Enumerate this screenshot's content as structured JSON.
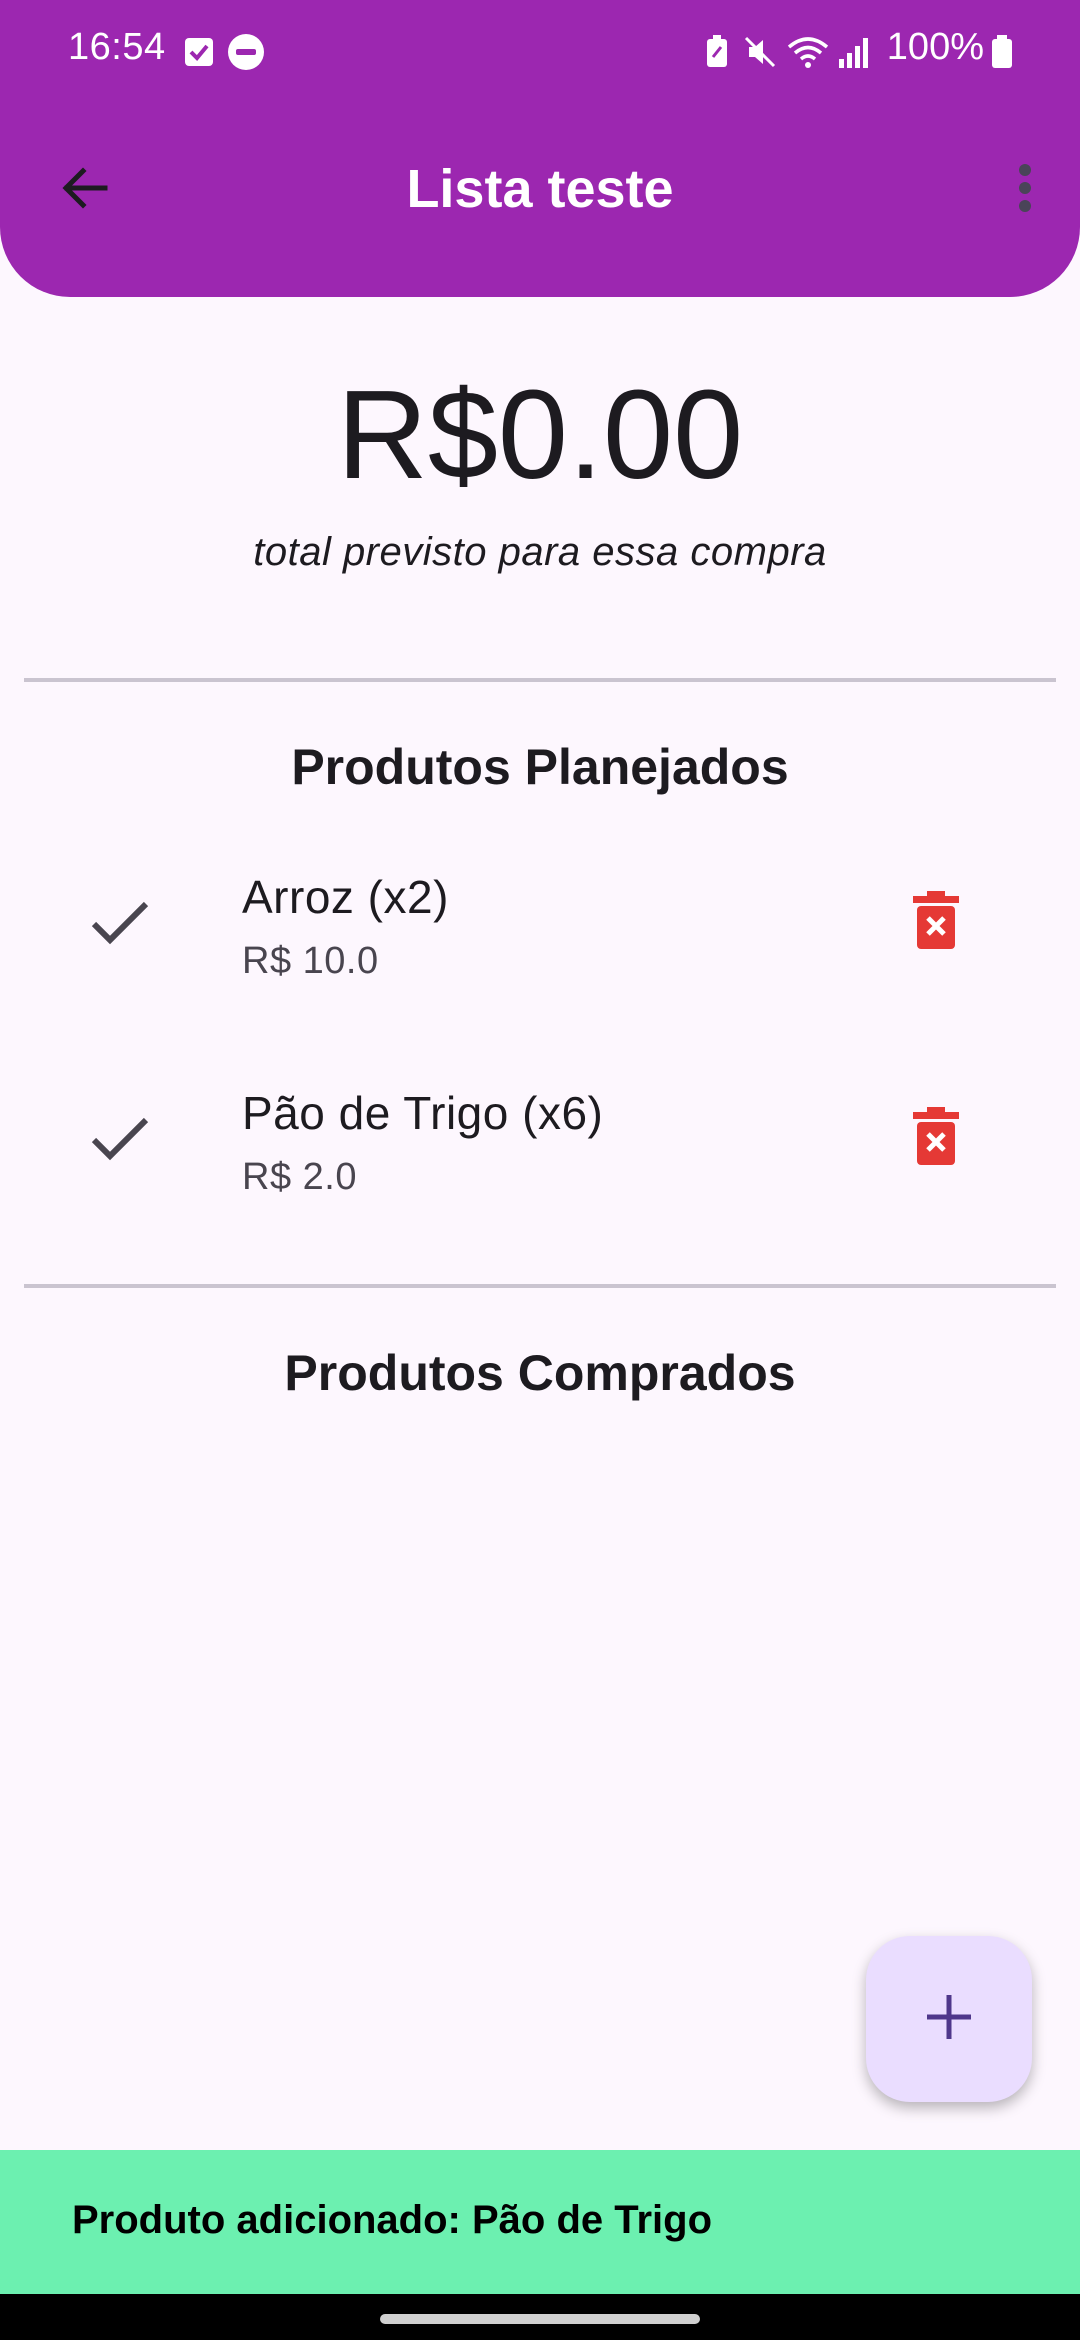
{
  "status_bar": {
    "time": "16:54",
    "battery": "100%",
    "icons": [
      "checkbox-notification-icon",
      "do-not-disturb-icon",
      "battery-saver-icon",
      "mute-icon",
      "wifi-icon",
      "signal-icon",
      "battery-icon"
    ]
  },
  "app_bar": {
    "title": "Lista teste",
    "back_icon": "arrow-back-icon",
    "menu_icon": "more-vert-icon",
    "color": "#9c27b0"
  },
  "summary": {
    "total": "R$0.00",
    "caption": "total previsto para essa compra"
  },
  "planned": {
    "title": "Produtos Planejados",
    "items": [
      {
        "name": "Arroz (x2)",
        "price": "R$ 10.0"
      },
      {
        "name": "Pão de Trigo (x6)",
        "price": "R$ 2.0"
      }
    ]
  },
  "purchased": {
    "title": "Produtos Comprados",
    "items": []
  },
  "fab": {
    "icon": "add-icon",
    "color": "#eaddff"
  },
  "snackbar": {
    "message": "Produto adicionado: Pão de Trigo",
    "color": "#6cf0b0"
  },
  "colors": {
    "delete": "#e53935",
    "background": "#fdf7fe"
  }
}
